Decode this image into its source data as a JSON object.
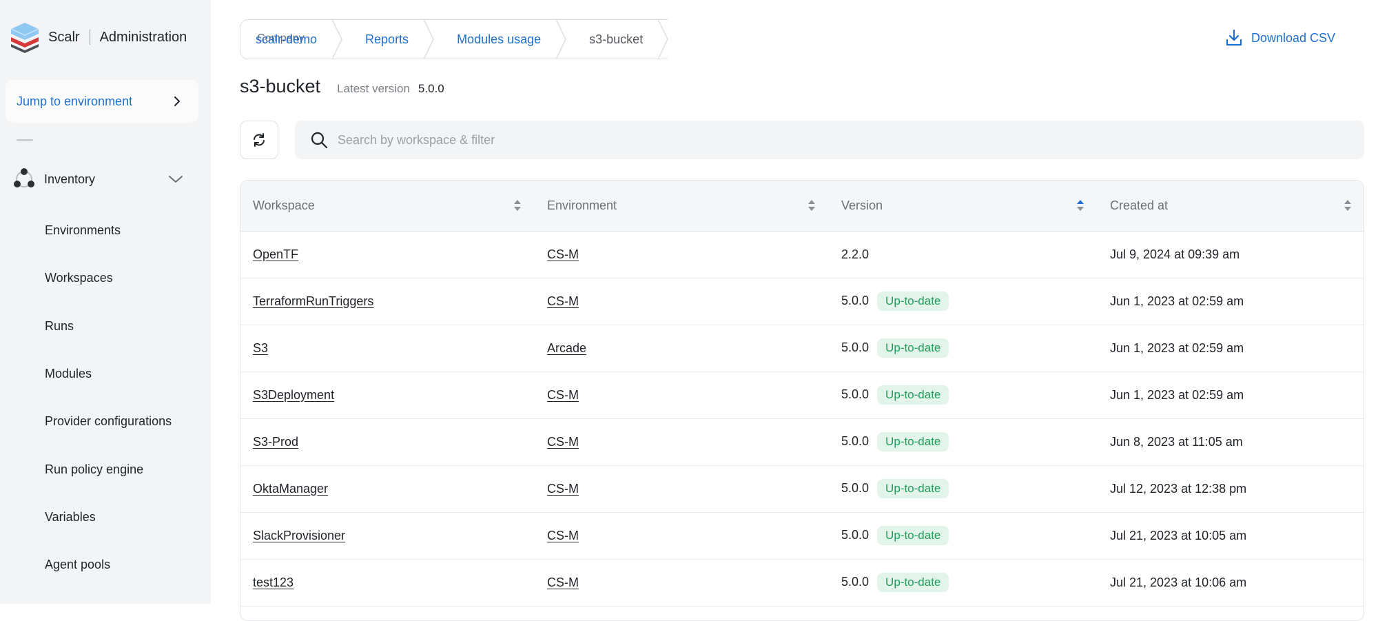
{
  "app": {
    "brand": "Scalr",
    "section": "Administration"
  },
  "sidebar": {
    "jump_label": "Jump to environment",
    "inventory_label": "Inventory",
    "items": [
      {
        "label": "Environments"
      },
      {
        "label": "Workspaces"
      },
      {
        "label": "Runs"
      },
      {
        "label": "Modules"
      },
      {
        "label": "Provider configurations"
      },
      {
        "label": "Run policy engine"
      },
      {
        "label": "Variables"
      },
      {
        "label": "Agent pools"
      }
    ]
  },
  "breadcrumb": {
    "company_label": "Company",
    "items": [
      {
        "label": "scalr-demo"
      },
      {
        "label": "Reports"
      },
      {
        "label": "Modules usage"
      },
      {
        "label": "s3-bucket"
      }
    ]
  },
  "header": {
    "download_label": "Download CSV",
    "title": "s3-bucket",
    "latest_label": "Latest version",
    "latest_value": "5.0.0"
  },
  "search": {
    "placeholder": "Search by workspace & filter",
    "value": ""
  },
  "table": {
    "columns": [
      {
        "label": "Workspace"
      },
      {
        "label": "Environment"
      },
      {
        "label": "Version"
      },
      {
        "label": "Created at"
      }
    ],
    "rows": [
      {
        "workspace": "OpenTF",
        "environment": "CS-M",
        "version": "2.2.0",
        "badge": "",
        "created": "Jul 9, 2024 at 09:39 am"
      },
      {
        "workspace": "TerraformRunTriggers",
        "environment": "CS-M",
        "version": "5.0.0",
        "badge": "Up-to-date",
        "created": "Jun 1, 2023 at 02:59 am"
      },
      {
        "workspace": "S3",
        "environment": "Arcade",
        "version": "5.0.0",
        "badge": "Up-to-date",
        "created": "Jun 1, 2023 at 02:59 am"
      },
      {
        "workspace": "S3Deployment",
        "environment": "CS-M",
        "version": "5.0.0",
        "badge": "Up-to-date",
        "created": "Jun 1, 2023 at 02:59 am"
      },
      {
        "workspace": "S3-Prod",
        "environment": "CS-M",
        "version": "5.0.0",
        "badge": "Up-to-date",
        "created": "Jun 8, 2023 at 11:05 am"
      },
      {
        "workspace": "OktaManager",
        "environment": "CS-M",
        "version": "5.0.0",
        "badge": "Up-to-date",
        "created": "Jul 12, 2023 at 12:38 pm"
      },
      {
        "workspace": "SlackProvisioner",
        "environment": "CS-M",
        "version": "5.0.0",
        "badge": "Up-to-date",
        "created": "Jul 21, 2023 at 10:05 am"
      },
      {
        "workspace": "test123",
        "environment": "CS-M",
        "version": "5.0.0",
        "badge": "Up-to-date",
        "created": "Jul 21, 2023 at 10:06 am"
      }
    ]
  },
  "colors": {
    "accent": "#1f6fcf",
    "success_bg": "#e3f5ea",
    "success_text": "#1e9e5a",
    "sidebar_bg": "#f3f4f6"
  }
}
